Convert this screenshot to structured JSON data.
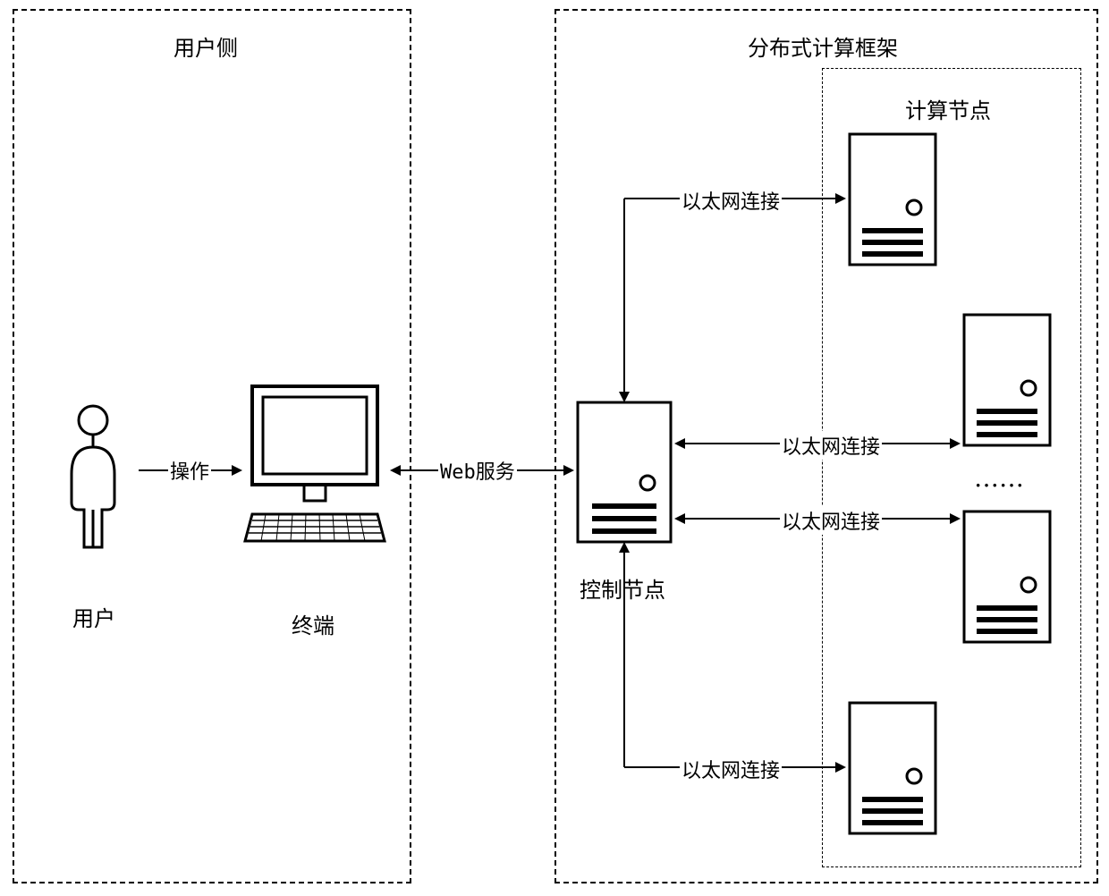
{
  "user_side": {
    "title": "用户侧",
    "user_label": "用户",
    "terminal_label": "终端",
    "operation_label": "操作"
  },
  "framework": {
    "title": "分布式计算框架",
    "web_service_label": "Web服务",
    "control_node_label": "控制节点",
    "compute_node_title": "计算节点",
    "ethernet_labels": [
      "以太网连接",
      "以太网连接",
      "以太网连接",
      "以太网连接"
    ],
    "ellipsis": "······"
  }
}
